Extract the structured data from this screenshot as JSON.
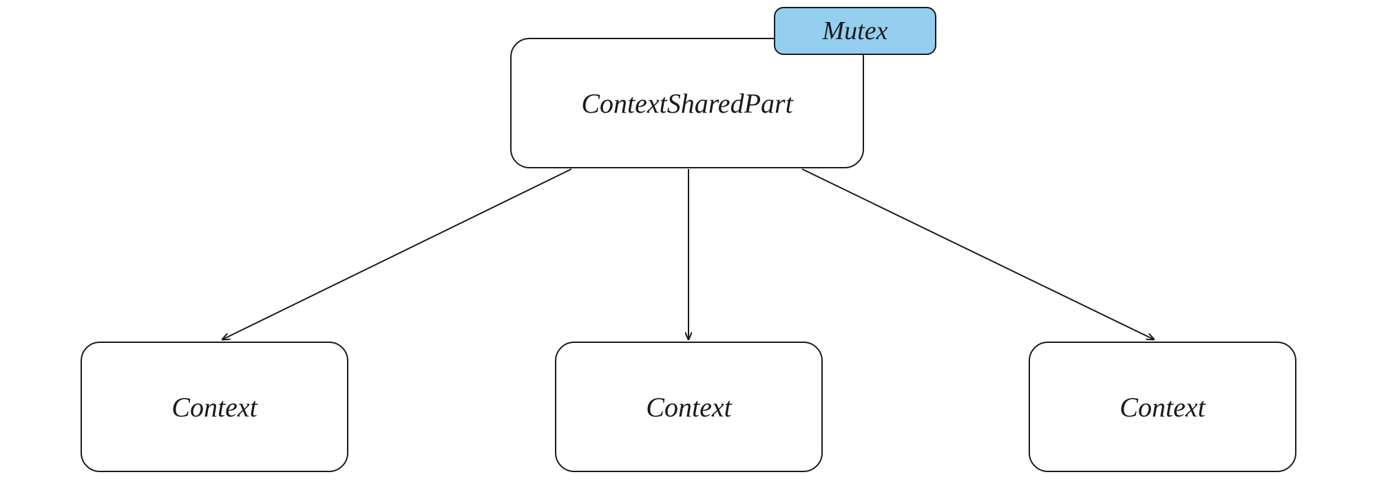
{
  "diagram": {
    "shared_part_label": "ContextSharedPart",
    "mutex_label": "Mutex",
    "context_left_label": "Context",
    "context_mid_label": "Context",
    "context_right_label": "Context"
  }
}
